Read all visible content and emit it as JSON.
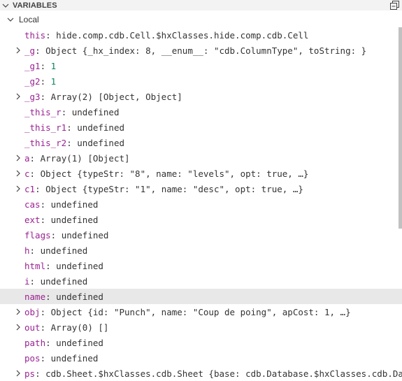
{
  "panel": {
    "title": "VARIABLES",
    "collapse_icon": "collapse-all-icon",
    "toggle_icon": "chevron-down-icon"
  },
  "scope": {
    "label": "Local",
    "expanded": true
  },
  "colors": {
    "name": "#9b2393",
    "number": "#098658",
    "text": "#333333",
    "selected_row": "#e8e8e8"
  },
  "variables": [
    {
      "name": "this",
      "value": "hide.comp.cdb.Cell.$hxClasses.hide.comp.cdb.Cell",
      "expandable": false,
      "kind": "text"
    },
    {
      "name": "_g",
      "value": "Object {_hx_index: 8, __enum__: \"cdb.ColumnType\", toString: }",
      "expandable": true,
      "kind": "text"
    },
    {
      "name": "_g1",
      "value": "1",
      "expandable": false,
      "kind": "num"
    },
    {
      "name": "_g2",
      "value": "1",
      "expandable": false,
      "kind": "num"
    },
    {
      "name": "_g3",
      "value": "Array(2) [Object, Object]",
      "expandable": true,
      "kind": "text"
    },
    {
      "name": "_this_r",
      "value": "undefined",
      "expandable": false,
      "kind": "text"
    },
    {
      "name": "_this_r1",
      "value": "undefined",
      "expandable": false,
      "kind": "text"
    },
    {
      "name": "_this_r2",
      "value": "undefined",
      "expandable": false,
      "kind": "text"
    },
    {
      "name": "a",
      "value": "Array(1) [Object]",
      "expandable": true,
      "kind": "text"
    },
    {
      "name": "c",
      "value": "Object {typeStr: \"8\", name: \"levels\", opt: true, …}",
      "expandable": true,
      "kind": "text"
    },
    {
      "name": "c1",
      "value": "Object {typeStr: \"1\", name: \"desc\", opt: true, …}",
      "expandable": true,
      "kind": "text"
    },
    {
      "name": "cas",
      "value": "undefined",
      "expandable": false,
      "kind": "text"
    },
    {
      "name": "ext",
      "value": "undefined",
      "expandable": false,
      "kind": "text"
    },
    {
      "name": "flags",
      "value": "undefined",
      "expandable": false,
      "kind": "text"
    },
    {
      "name": "h",
      "value": "undefined",
      "expandable": false,
      "kind": "text"
    },
    {
      "name": "html",
      "value": "undefined",
      "expandable": false,
      "kind": "text"
    },
    {
      "name": "i",
      "value": "undefined",
      "expandable": false,
      "kind": "text"
    },
    {
      "name": "name",
      "value": "undefined",
      "expandable": false,
      "kind": "text",
      "selected": true
    },
    {
      "name": "obj",
      "value": "Object {id: \"Punch\", name: \"Coup de poing\", apCost: 1, …}",
      "expandable": true,
      "kind": "text"
    },
    {
      "name": "out",
      "value": "Array(0) []",
      "expandable": true,
      "kind": "text"
    },
    {
      "name": "path",
      "value": "undefined",
      "expandable": false,
      "kind": "text"
    },
    {
      "name": "pos",
      "value": "undefined",
      "expandable": false,
      "kind": "text"
    },
    {
      "name": "ps",
      "value": "cdb.Sheet.$hxClasses.cdb.Sheet {base: cdb.Database.$hxClasses.cdb.Datab",
      "expandable": true,
      "kind": "text"
    }
  ]
}
